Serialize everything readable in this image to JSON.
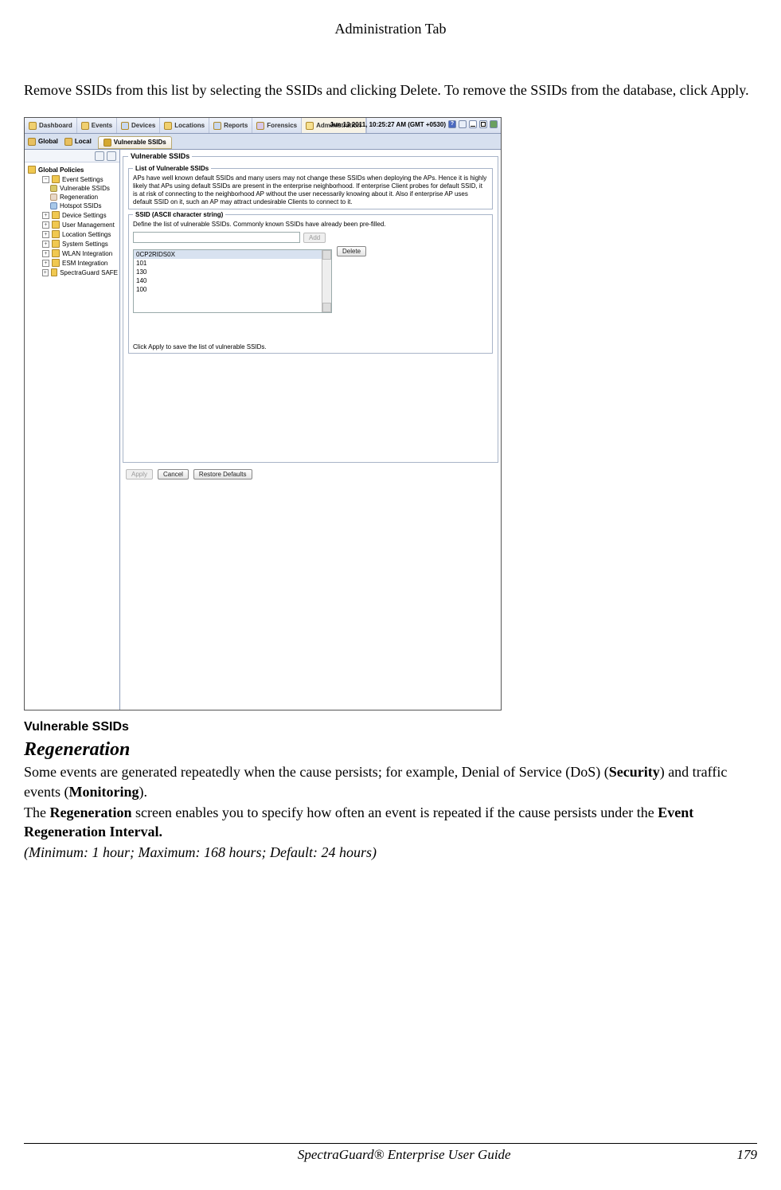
{
  "page": {
    "header": "Administration Tab",
    "intro": "Remove SSIDs from this list by selecting the SSIDs and clicking Delete. To remove the SSIDs from the database, click Apply."
  },
  "app": {
    "tabs": [
      "Dashboard",
      "Events",
      "Devices",
      "Locations",
      "Reports",
      "Forensics",
      "Administration"
    ],
    "timestamp": "Jun 13 2011, 10:25:27 AM (GMT +0530)",
    "scope": {
      "global": "Global",
      "local": "Local",
      "active": "Vulnerable SSIDs"
    }
  },
  "tree": {
    "root": "Global Policies",
    "items": [
      {
        "label": "Event Settings",
        "expanded": true,
        "children": [
          {
            "label": "Vulnerable SSIDs",
            "icon": "vuln",
            "selected": true
          },
          {
            "label": "Regeneration",
            "icon": "regen"
          },
          {
            "label": "Hotspot SSIDs",
            "icon": "hotspot"
          }
        ]
      },
      {
        "label": "Device Settings"
      },
      {
        "label": "User Management"
      },
      {
        "label": "Location Settings"
      },
      {
        "label": "System Settings"
      },
      {
        "label": "WLAN Integration"
      },
      {
        "label": "ESM Integration"
      },
      {
        "label": "SpectraGuard SAFE"
      }
    ]
  },
  "panel": {
    "title": "Vulnerable SSIDs",
    "section1": {
      "legend": "List of Vulnerable SSIDs",
      "text": "APs have well known default SSIDs and many users may not change these SSIDs when deploying the APs. Hence it is highly likely that APs using default SSIDs are present in the enterprise neighborhood. If enterprise Client probes for default SSID, it is at risk of connecting to the neighborhood AP without the user necessarily knowing about it. Also if enterprise AP uses default SSID on it, such an AP may attract undesirable Clients to connect to it."
    },
    "section2": {
      "legend": "SSID (ASCII character string)",
      "text": "Define the list of vulnerable SSIDs. Commonly known SSIDs have already been pre-filled.",
      "add_label": "Add",
      "delete_label": "Delete",
      "items": [
        "0CP2RIDS0X",
        "101",
        "130",
        "140",
        "100"
      ],
      "save_hint": "Click Apply to save the list of vulnerable SSIDs."
    },
    "buttons": {
      "apply": "Apply",
      "cancel": "Cancel",
      "restore": "Restore Defaults"
    }
  },
  "below": {
    "caption": "Vulnerable SSIDs",
    "heading": "Regeneration",
    "p1_pre": "Some events are generated repeatedly when the cause persists; for example, Denial of Service (DoS) (",
    "p1_b1": "Security",
    "p1_mid": ") and traffic events (",
    "p1_b2": "Monitoring",
    "p1_post": ").",
    "p2_pre": "The ",
    "p2_b1": "Regeneration",
    "p2_mid": " screen enables you to specify how often an event is repeated if the cause persists under the ",
    "p2_b2": "Event Regeneration Interval.",
    "p3": "(Minimum: 1 hour; Maximum: 168 hours; Default: 24 hours)"
  },
  "footer": {
    "title": "SpectraGuard® Enterprise User Guide",
    "page": "179"
  }
}
